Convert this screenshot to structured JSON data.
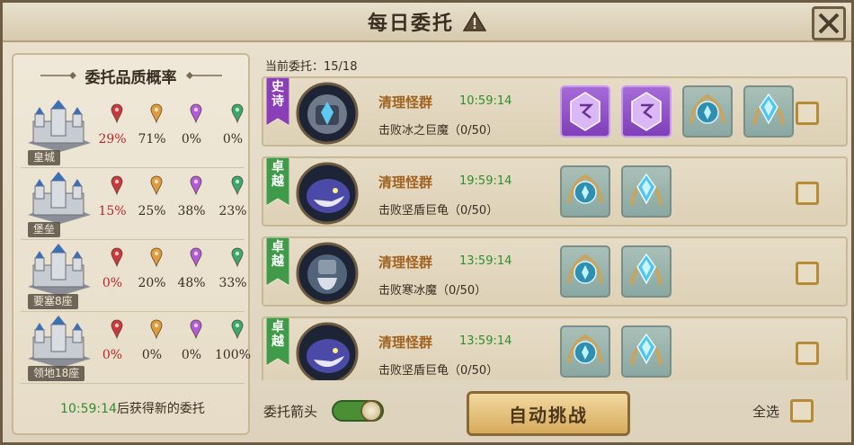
{
  "window": {
    "title": "每日委托",
    "colors": {
      "parchment": "#e6dcc7",
      "accent_gold": "#b78a35",
      "timer_green": "#2f8f2a",
      "task_name_orange": "#a0621e",
      "pct_red": "#b3262a"
    }
  },
  "quality_panel": {
    "title": "委托品质概率",
    "gem_colors": [
      "#c8383c",
      "#e39a3a",
      "#b35ad6",
      "#3aa86a"
    ],
    "tiers": [
      {
        "label": "皇城",
        "pcts": [
          "29%",
          "71%",
          "0%",
          "0%"
        ]
      },
      {
        "label": "堡垒",
        "pcts": [
          "15%",
          "25%",
          "38%",
          "23%"
        ]
      },
      {
        "label": "要塞8座",
        "pcts": [
          "0%",
          "20%",
          "48%",
          "33%"
        ]
      },
      {
        "label": "领地18座",
        "pcts": [
          "0%",
          "0%",
          "0%",
          "100%"
        ]
      }
    ],
    "refresh_time": "10:59:14",
    "refresh_suffix": "后获得新的委托"
  },
  "commissions": {
    "count_label": "当前委托：15/18",
    "tasks": [
      {
        "rarity": "史诗",
        "rarity_color": "#8a3fb8",
        "name": "清理怪群",
        "time": "10:59:14",
        "desc": "击败冰之巨魔（0/50）",
        "monster": "ice-giant-portrait",
        "rewards": [
          "purple-rune-reward-icon",
          "purple-rune-reward-icon",
          "blue-emblem-reward-icon",
          "blue-crystal-reward-icon"
        ]
      },
      {
        "rarity": "卓越",
        "rarity_color": "#3f9a4a",
        "name": "清理怪群",
        "time": "19:59:14",
        "desc": "击败坚盾巨龟（0/50）",
        "monster": "shield-turtle-portrait",
        "rewards": [
          "blue-emblem-reward-icon",
          "blue-crystal-reward-icon"
        ]
      },
      {
        "rarity": "卓越",
        "rarity_color": "#3f9a4a",
        "name": "清理怪群",
        "time": "13:59:14",
        "desc": "击败寒冰魔（0/50）",
        "monster": "frost-demon-portrait",
        "rewards": [
          "blue-emblem-reward-icon",
          "blue-crystal-reward-icon"
        ]
      },
      {
        "rarity": "卓越",
        "rarity_color": "#3f9a4a",
        "name": "清理怪群",
        "time": "13:59:14",
        "desc": "击败坚盾巨龟（0/50）",
        "monster": "shield-turtle-portrait",
        "rewards": [
          "blue-emblem-reward-icon",
          "blue-crystal-reward-icon"
        ]
      }
    ]
  },
  "footer": {
    "arrow_label": "委托箭头",
    "toggle_on": true,
    "auto_button": "自动挑战",
    "select_all": "全选"
  }
}
